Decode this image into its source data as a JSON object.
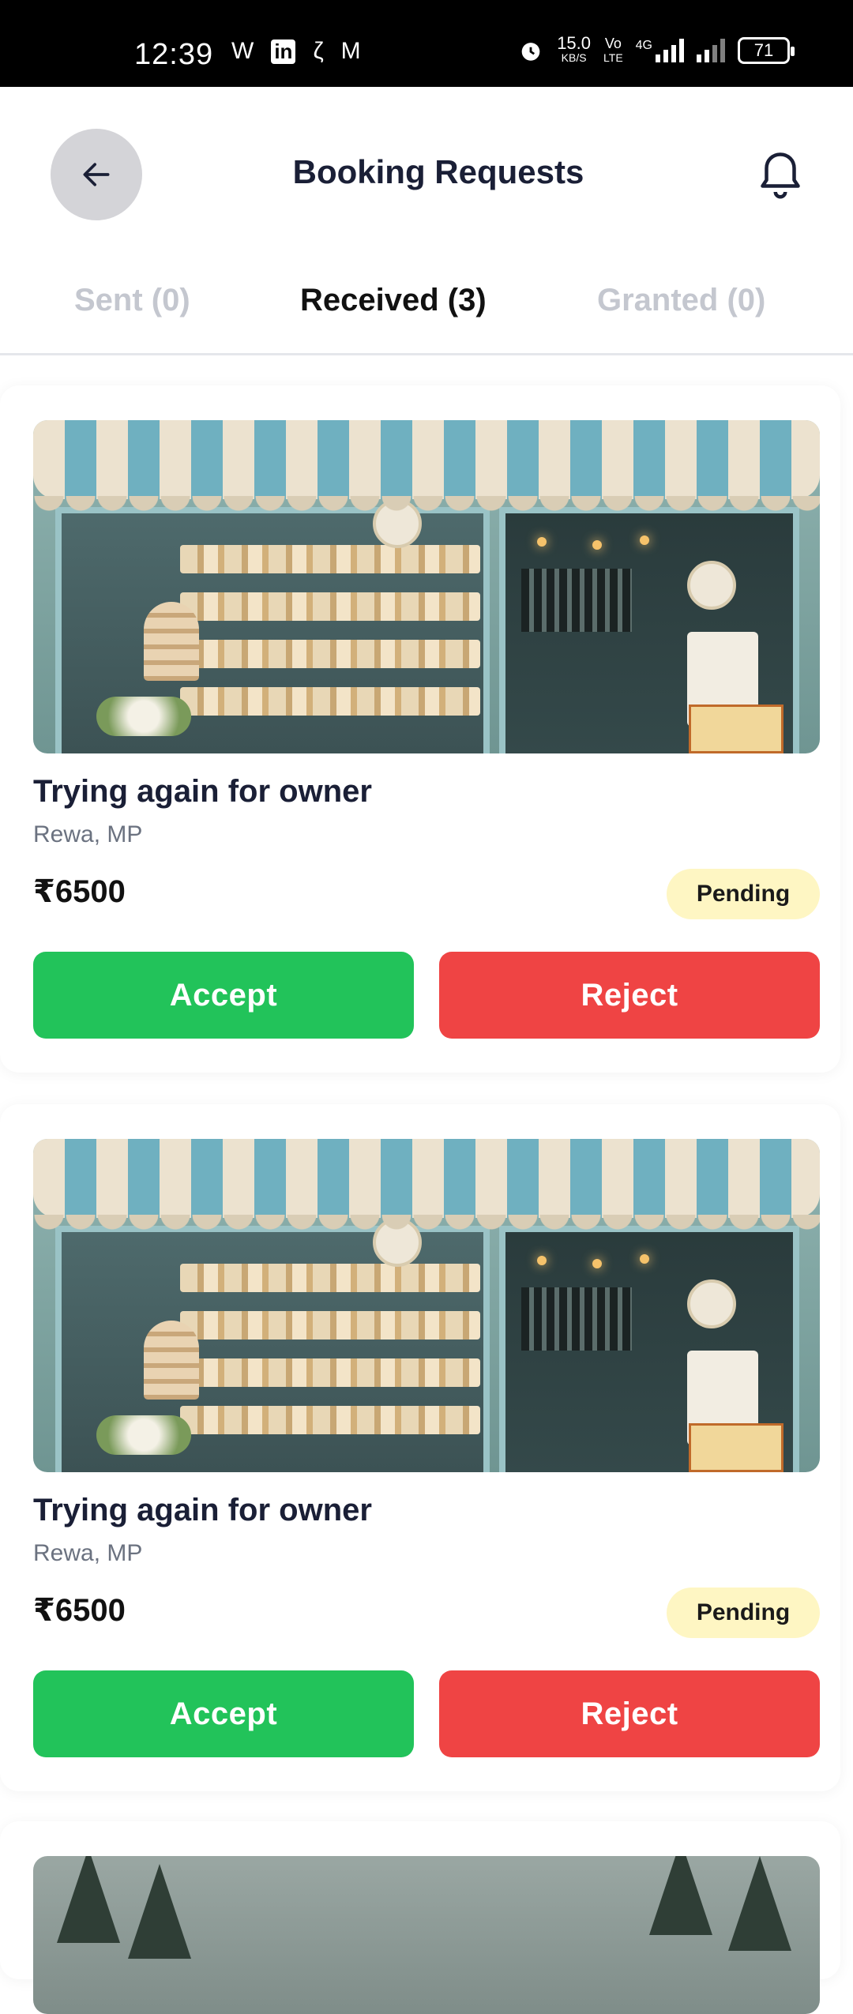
{
  "status_bar": {
    "time": "12:39",
    "net_speed_value": "15.0",
    "net_speed_unit": "KB/S",
    "volte_top": "Vo",
    "volte_bottom": "LTE",
    "network": "4G",
    "battery": "71"
  },
  "header": {
    "title": "Booking Requests"
  },
  "tabs": [
    {
      "label": "Sent (0)",
      "active": false
    },
    {
      "label": "Received (3)",
      "active": true
    },
    {
      "label": "Granted (0)",
      "active": false
    }
  ],
  "bookings": [
    {
      "title": "Trying again for owner",
      "location": "Rewa, MP",
      "price": "₹6500",
      "status": "Pending",
      "accept_label": "Accept",
      "reject_label": "Reject"
    },
    {
      "title": "Trying again for owner",
      "location": "Rewa, MP",
      "price": "₹6500",
      "status": "Pending",
      "accept_label": "Accept",
      "reject_label": "Reject"
    }
  ],
  "colors": {
    "accept": "#22c35a",
    "reject": "#ef4444",
    "pending_badge": "#fef6c3",
    "back_button": "#d4d4d8"
  }
}
